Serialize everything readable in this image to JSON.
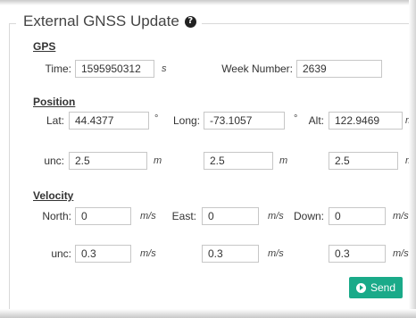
{
  "panel": {
    "title": "External GNSS Update"
  },
  "gps": {
    "heading": "GPS",
    "time_label": "Time:",
    "time_value": "1595950312",
    "time_unit": "s",
    "week_label": "Week Number:",
    "week_value": "2639"
  },
  "position": {
    "heading": "Position",
    "lat_label": "Lat:",
    "lat_value": "44.4377",
    "lat_unit": "°",
    "long_label": "Long:",
    "long_value": "-73.1057",
    "long_unit": "°",
    "alt_label": "Alt:",
    "alt_value": "122.9469",
    "alt_unit": "m",
    "unc_label": "unc:",
    "unc1": "2.5",
    "unc1_unit": "m",
    "unc2": "2.5",
    "unc2_unit": "m",
    "unc3": "2.5",
    "unc3_unit": "m"
  },
  "velocity": {
    "heading": "Velocity",
    "north_label": "North:",
    "north_value": "0",
    "north_unit": "m/s",
    "east_label": "East:",
    "east_value": "0",
    "east_unit": "m/s",
    "down_label": "Down:",
    "down_value": "0",
    "down_unit": "m/s",
    "unc_label": "unc:",
    "unc1": "0.3",
    "unc1_unit": "m/s",
    "unc2": "0.3",
    "unc2_unit": "m/s",
    "unc3": "0.3",
    "unc3_unit": "m/s"
  },
  "actions": {
    "send_label": "Send"
  }
}
